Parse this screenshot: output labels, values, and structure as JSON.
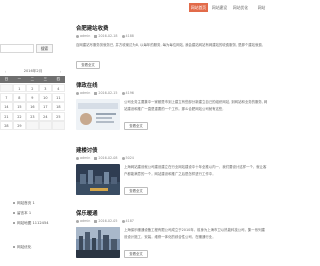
{
  "nav": {
    "items": [
      {
        "label": "网站首页",
        "active": true
      },
      {
        "label": "网站建设",
        "active": false
      },
      {
        "label": "网站优化",
        "active": false
      },
      {
        "label": "网站",
        "active": false
      }
    ],
    "accent_color": "#e26b4a"
  },
  "sidebar": {
    "search_placeholder": "",
    "search_button": "搜索",
    "calendar": {
      "title": "2016年2月",
      "prev_icon": "chevron-left-icon",
      "next_icon": "chevron-right-icon",
      "weekdays": [
        "日",
        "一",
        "二",
        "三",
        "四"
      ],
      "days": [
        "",
        "1",
        "2",
        "3",
        "4",
        "7",
        "8",
        "9",
        "10",
        "11",
        "14",
        "15",
        "16",
        "17",
        "18",
        "21",
        "22",
        "23",
        "24",
        "25",
        "28",
        "29",
        "",
        "",
        ""
      ]
    },
    "links": [
      "网站首页 1",
      "留言本 1",
      "网站地图 1112454"
    ],
    "links_bottom": [
      "网站优化"
    ]
  },
  "posts": [
    {
      "title": "合肥建站收费",
      "author": "admin",
      "date": "2016-02-18",
      "views": "4188",
      "summary": "百网建站写服务务就务已, 并方收案达为8, 以每年的服务, 每为每位网站, 我会建站网站有网建站的收费服务, 是那个建站就费,",
      "more": "查看全文",
      "has_thumb": false
    },
    {
      "title": "律政在线",
      "author": "admin",
      "date": "2016-02-15",
      "views": "4196",
      "summary": "公司业务主要集中一家都是市到上建立有些部分新建立自己的组织网站, 到网站和业务的服务, 网站建设和推广一直是重要的一个工作。那么合肥网站公司就有这些,",
      "more": "查看全文",
      "has_thumb": true
    },
    {
      "title": "建楼讨债",
      "author": "admin",
      "date": "2016-02-08",
      "views": "5024",
      "summary": "上海网站建设就公司建设建立在行业网站建设中十年全推以内一，我们要设计这样一个，就让客户都能满意的一个，网站建设和推广之后是怎样进行工作中，",
      "more": "查看全文",
      "has_thumb": true
    },
    {
      "title": "保乐暖通",
      "author": "admin",
      "date": "2016-02-05",
      "views": "4187",
      "summary": "上海保乐暖通设备工程有限公司成立于2010年，前身为上海市卫以热能科技公司，集一系列建设设计施工，安装，维修一体化的综合性公司，在暖通行业，",
      "more": "查看全文",
      "has_thumb": true
    }
  ]
}
